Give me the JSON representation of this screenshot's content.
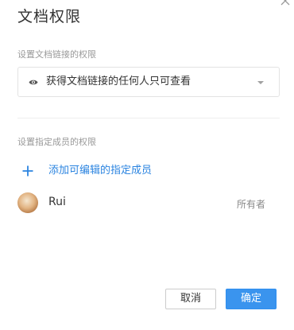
{
  "dialog": {
    "title": "文档权限",
    "close_icon": "close-icon"
  },
  "link_permission": {
    "label": "设置文档链接的权限",
    "icon": "eye-icon",
    "selected_value": "获得文档链接的任何人只可查看"
  },
  "member_permission": {
    "label": "设置指定成员的权限",
    "add_button_label": "添加可编辑的指定成员",
    "members": [
      {
        "name": "Rui",
        "role": "所有者"
      }
    ]
  },
  "footer": {
    "cancel_label": "取消",
    "ok_label": "确定"
  },
  "colors": {
    "accent": "#3a94ee",
    "link": "#2b84e0"
  }
}
